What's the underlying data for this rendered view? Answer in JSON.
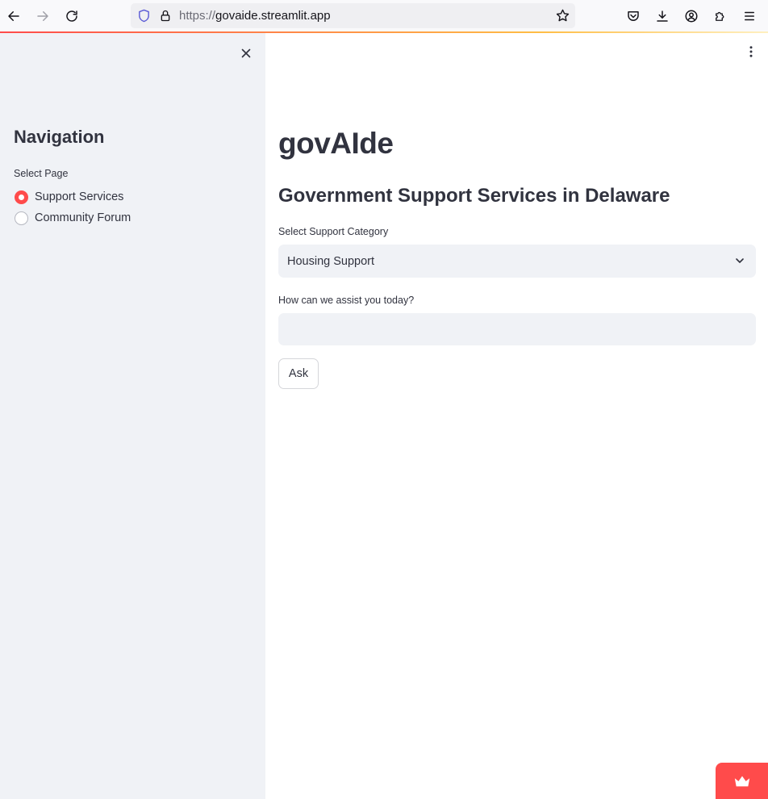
{
  "browser": {
    "url_scheme": "https://",
    "url_host": "govaide.streamlit.app",
    "icons": {
      "back": "arrow-left-icon",
      "forward": "arrow-right-icon",
      "reload": "reload-icon",
      "shield": "tracking-shield-icon",
      "lock": "lock-icon",
      "bookmark": "star-icon",
      "pocket": "pocket-icon",
      "downloads": "download-icon",
      "account": "account-icon",
      "extensions": "puzzle-icon",
      "menu": "hamburger-icon"
    }
  },
  "sidebar": {
    "title": "Navigation",
    "select_label": "Select Page",
    "options": [
      {
        "label": "Support Services",
        "checked": true
      },
      {
        "label": "Community Forum",
        "checked": false
      }
    ]
  },
  "main": {
    "title": "govAIde",
    "subtitle": "Government Support Services in Delaware",
    "category_label": "Select Support Category",
    "category_value": "Housing Support",
    "question_label": "How can we assist you today?",
    "question_value": "",
    "ask_label": "Ask"
  },
  "colors": {
    "accent": "#ff4b4b",
    "sidebar_bg": "#f0f2f6",
    "text": "#31333f"
  }
}
